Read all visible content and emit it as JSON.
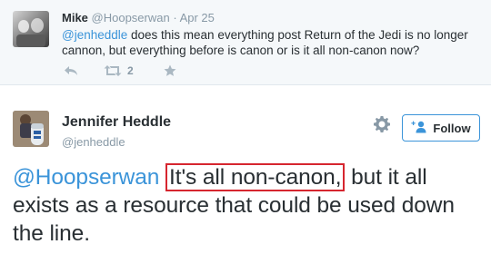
{
  "reply": {
    "name": "Mike",
    "handle": "@Hoopserwan",
    "separator": "·",
    "date": "Apr 25",
    "mention": "@jenheddle",
    "text": " does this mean everything post Return of the Jedi is no longer cannon, but everything before is canon or is it all non-canon now?",
    "retweet_count": "2",
    "actions": {
      "reply_icon": "reply-arrow-icon",
      "retweet_icon": "retweet-icon",
      "favorite_icon": "star-icon"
    }
  },
  "tweet": {
    "name": "Jennifer Heddle",
    "handle": "@jenheddle",
    "follow_label": "Follow",
    "mention": "@Hoopserwan",
    "highlighted_text": "It's all non-canon,",
    "rest_text": " but it all exists as a resource that could be used down the line.",
    "highlight_color": "#d6262f",
    "gear_icon": "gear-icon",
    "follow_icon": "add-user-icon"
  },
  "colors": {
    "link": "#3b94d9",
    "muted": "#8899a6",
    "text": "#292f33",
    "reply_bg": "#f5f8fa"
  }
}
